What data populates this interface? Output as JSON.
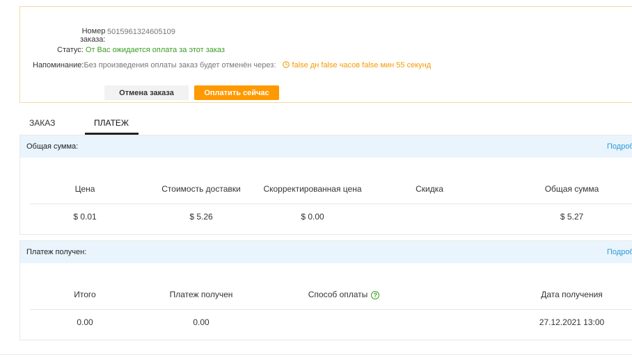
{
  "order": {
    "number_label_line1": "Номер",
    "number_label_line2": "заказа:",
    "number_value": "5015961324605109",
    "status_label": "Статус:",
    "status_value": "От Вас ожидается оплата за этот заказ",
    "reminder_label": "Напоминание:",
    "reminder_text": "Без произведения оплаты заказ будет отменён через:",
    "countdown": "false дн false часов false мин 55 секунд",
    "cancel_button": "Отмена заказа",
    "pay_button": "Оплатить сейчас"
  },
  "tabs": [
    {
      "label": "ЗАКАЗ",
      "active": false
    },
    {
      "label": "ПЛАТЕЖ",
      "active": true
    }
  ],
  "total_card": {
    "title": "Общая сумма:",
    "details_link": "Подроб",
    "columns": [
      "Цена",
      "Стоимость доставки",
      "Скорректированная цена",
      "Скидка",
      "Общая сумма"
    ],
    "values": [
      "$ 0.01",
      "$ 5.26",
      "$ 0.00",
      "",
      "$ 5.27"
    ]
  },
  "payment_card": {
    "title": "Платеж получен:",
    "details_link": "Подроб",
    "columns": [
      "Итого",
      "Платеж получен",
      "Способ оплаты",
      "Дата получения"
    ],
    "values": [
      "0.00",
      "0.00",
      "",
      "27.12.2021 13:00"
    ]
  },
  "colors": {
    "accent_orange": "#ff9900",
    "status_green": "#3a9d23",
    "link_blue": "#2b9bd8",
    "header_bg": "#eaf4fc"
  },
  "icons": {
    "countdown": "clock-icon",
    "payment_method_help": "question-circle-icon"
  }
}
